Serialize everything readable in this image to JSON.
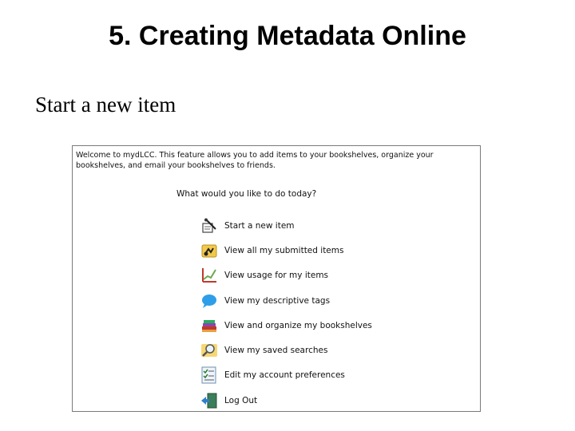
{
  "slide": {
    "title": "5. Creating Metadata Online",
    "subtitle": "Start a new item"
  },
  "screenshot": {
    "welcome_text": "Welcome to mydLCC. This feature allows you to add items to your bookshelves, organize your bookshelves, and email your bookshelves to friends.",
    "question": "What would you like to do today?",
    "menu": [
      {
        "label": "Start a new item",
        "icon": "pen-document-icon"
      },
      {
        "label": "View all my submitted items",
        "icon": "submitted-items-icon"
      },
      {
        "label": "View usage for my items",
        "icon": "usage-chart-icon"
      },
      {
        "label": "View my descriptive tags",
        "icon": "speech-bubble-icon"
      },
      {
        "label": "View and organize my bookshelves",
        "icon": "books-icon"
      },
      {
        "label": "View my saved searches",
        "icon": "magnifier-icon"
      },
      {
        "label": "Edit my account preferences",
        "icon": "checklist-icon"
      },
      {
        "label": "Log Out",
        "icon": "logout-door-icon"
      }
    ]
  }
}
